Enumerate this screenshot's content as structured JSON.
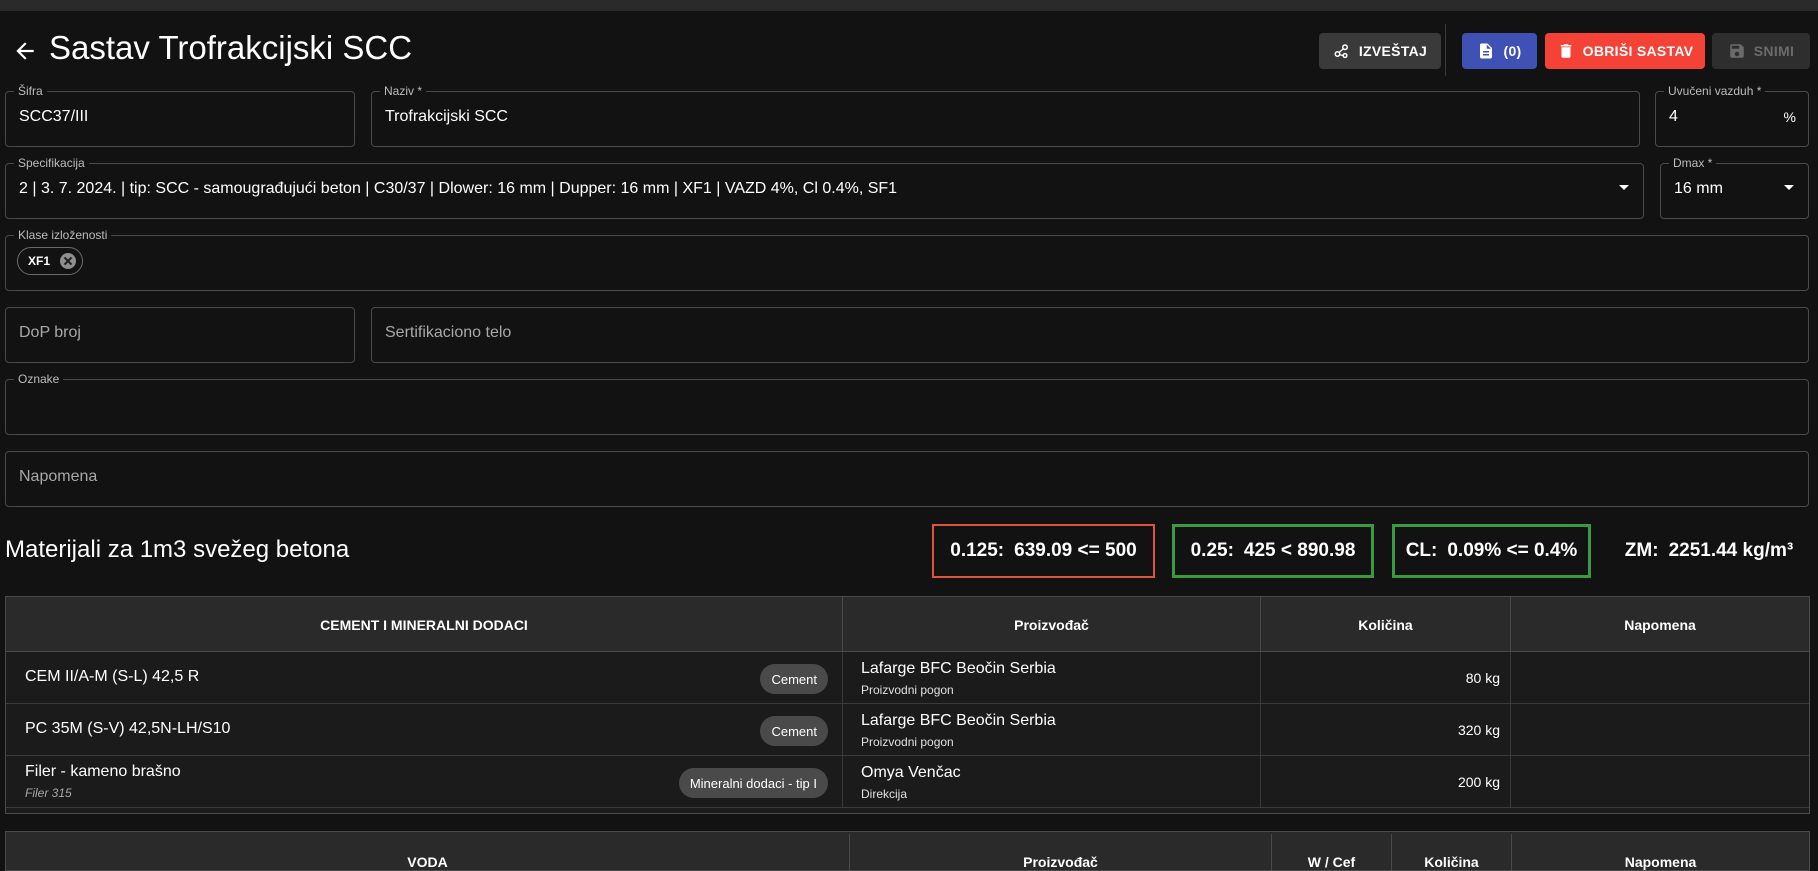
{
  "header": {
    "title": "Sastav Trofrakcijski SCC",
    "report_label": "IZVEŠTAJ",
    "docs_label": "(0)",
    "delete_label": "OBRIŠI SASTAV",
    "save_label": "SNIMI"
  },
  "form": {
    "sifra": {
      "label": "Šifra",
      "value": "SCC37/III"
    },
    "naziv": {
      "label": "Naziv *",
      "value": "Trofrakcijski SCC"
    },
    "uvuceni": {
      "label": "Uvučeni vazduh *",
      "value": "4",
      "suffix": "%"
    },
    "specifikacija": {
      "label": "Specifikacija",
      "value": "2 | 3. 7. 2024. | tip: SCC - samougrađujući beton | C30/37 | Dlower: 16 mm | Dupper: 16 mm | XF1 | VAZD 4%, Cl 0.4%, SF1"
    },
    "dmax": {
      "label": "Dmax *",
      "value": "16 mm"
    },
    "klase": {
      "label": "Klase izloženosti",
      "chips": [
        "XF1"
      ]
    },
    "dop": {
      "placeholder": "DoP broj"
    },
    "sertifikaciono": {
      "placeholder": "Sertifikaciono telo"
    },
    "oznake": {
      "label": "Oznake",
      "value": ""
    },
    "napomena": {
      "placeholder": "Napomena"
    }
  },
  "materials": {
    "title": "Materijali za 1m3 svežeg betona",
    "stats": [
      {
        "label": "0.125:",
        "value": "639.09 <= 500",
        "status": "error"
      },
      {
        "label": "0.25:",
        "value": "425 < 890.98",
        "status": "ok"
      },
      {
        "label": "CL:",
        "value": "0.09% <= 0.4%",
        "status": "ok"
      },
      {
        "label": "ZM:",
        "value": "2251.44 kg/m³",
        "status": "neutral"
      }
    ],
    "cement_table": {
      "headers": [
        "CEMENT I MINERALNI DODACI",
        "Proizvođač",
        "Količina",
        "Napomena"
      ],
      "rows": [
        {
          "name": "CEM II/A-M (S-L) 42,5 R",
          "sub": "",
          "tag": "Cement",
          "producer": "Lafarge BFC Beočin Serbia",
          "producer_sub": "Proizvodni pogon",
          "qty": "80 kg",
          "note": ""
        },
        {
          "name": "PC 35M (S-V) 42,5N-LH/S10",
          "sub": "",
          "tag": "Cement",
          "producer": "Lafarge BFC Beočin Serbia",
          "producer_sub": "Proizvodni pogon",
          "qty": "320 kg",
          "note": ""
        },
        {
          "name": "Filer - kameno brašno",
          "sub": "Filer 315",
          "tag": "Mineralni dodaci - tip I",
          "producer": "Omya Venčac",
          "producer_sub": "Direkcija",
          "qty": "200 kg",
          "note": ""
        }
      ]
    },
    "water_table": {
      "headers": [
        "VODA",
        "Proizvođač",
        "W / Cef",
        "Količina",
        "Napomena"
      ]
    }
  },
  "colors": {
    "background": "#121212",
    "docs_button": "#3f51b5",
    "delete_button": "#f44336",
    "stat_error": "#e0533f",
    "stat_ok": "#3a9a3f"
  }
}
